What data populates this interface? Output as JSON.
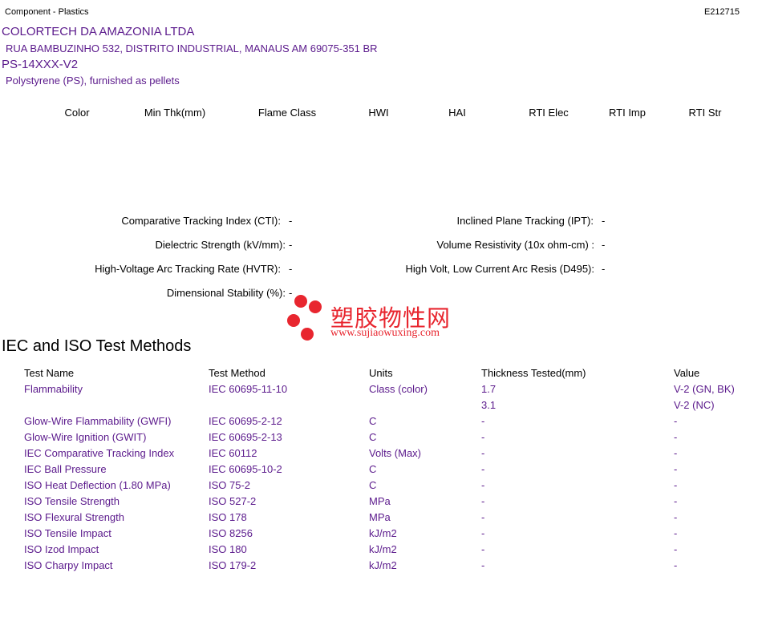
{
  "header": {
    "category": "Component - Plastics",
    "file_number": "E212715"
  },
  "company": {
    "name": "COLORTECH DA AMAZONIA LTDA",
    "address": "RUA BAMBUZINHO 532, DISTRITO INDUSTRIAL, MANAUS AM   69075-351 BR"
  },
  "product": {
    "grade": "PS-14XXX-V2",
    "description": "Polystyrene (PS), furnished as pellets"
  },
  "ratings_headers": [
    "Color",
    "Min Thk(mm)",
    "Flame Class",
    "HWI",
    "HAI",
    "RTI Elec",
    "RTI Imp",
    "RTI Str"
  ],
  "properties": {
    "cti_label": "Comparative Tracking Index (CTI):",
    "cti_value": "-",
    "ipt_label": "Inclined Plane Tracking (IPT):",
    "ipt_value": "-",
    "dielectric_label": "Dielectric Strength (kV/mm):",
    "dielectric_value": "-",
    "volume_label": "Volume Resistivity (10x ohm-cm) :",
    "volume_value": "-",
    "hvtr_label": "High-Voltage Arc Tracking Rate (HVTR):",
    "hvtr_value": "-",
    "d495_label": "High Volt, Low Current Arc Resis (D495):",
    "d495_value": "-",
    "dimensional_label": "Dimensional Stability (%):",
    "dimensional_value": "-"
  },
  "watermark": {
    "cn_text": "塑胶物性网",
    "url": "www.sujiaowuxing.com",
    "dot_color": "#e8262f"
  },
  "iec": {
    "title": "IEC and ISO Test Methods",
    "headers": {
      "test_name": "Test Name",
      "test_method": "Test Method",
      "units": "Units",
      "thickness": "Thickness Tested(mm)",
      "value": "Value"
    },
    "rows": [
      {
        "name": "Flammability",
        "method": "IEC 60695-11-10",
        "units": "Class (color)",
        "thickness": "1.7",
        "value": "V-2 (GN, BK)"
      },
      {
        "name": "",
        "method": "",
        "units": "",
        "thickness": "3.1",
        "value": "V-2 (NC)"
      },
      {
        "name": "Glow-Wire Flammability (GWFI)",
        "method": "IEC 60695-2-12",
        "units": "C",
        "thickness": "-",
        "value": "-"
      },
      {
        "name": "Glow-Wire Ignition (GWIT)",
        "method": "IEC 60695-2-13",
        "units": "C",
        "thickness": "-",
        "value": "-"
      },
      {
        "name": "IEC Comparative Tracking Index",
        "method": "IEC 60112",
        "units": "Volts (Max)",
        "thickness": "-",
        "value": "-"
      },
      {
        "name": "IEC Ball Pressure",
        "method": "IEC 60695-10-2",
        "units": "C",
        "thickness": "-",
        "value": "-"
      },
      {
        "name": "ISO Heat Deflection (1.80 MPa)",
        "method": "ISO 75-2",
        "units": "C",
        "thickness": "-",
        "value": "-"
      },
      {
        "name": "ISO Tensile Strength",
        "method": "ISO 527-2",
        "units": "MPa",
        "thickness": "-",
        "value": "-"
      },
      {
        "name": "ISO Flexural Strength",
        "method": "ISO 178",
        "units": "MPa",
        "thickness": "-",
        "value": "-"
      },
      {
        "name": "ISO Tensile Impact",
        "method": "ISO 8256",
        "units": "kJ/m2",
        "thickness": "-",
        "value": "-"
      },
      {
        "name": "ISO Izod Impact",
        "method": "ISO 180",
        "units": "kJ/m2",
        "thickness": "-",
        "value": "-"
      },
      {
        "name": "ISO Charpy Impact",
        "method": "ISO 179-2",
        "units": "kJ/m2",
        "thickness": "-",
        "value": "-"
      }
    ]
  }
}
